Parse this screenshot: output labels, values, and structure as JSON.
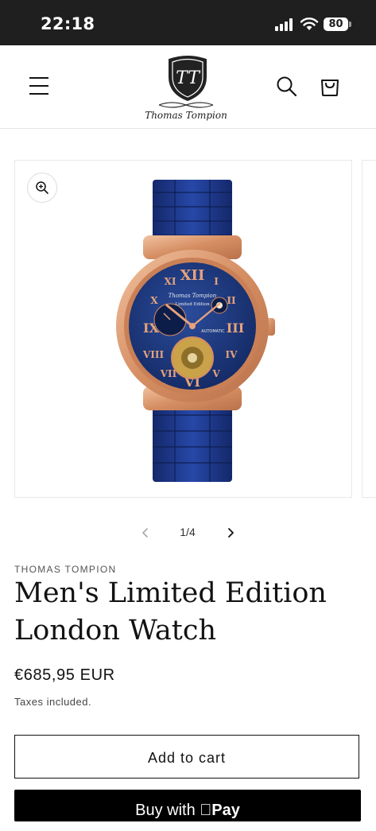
{
  "status_bar": {
    "time": "22:18",
    "battery": "80"
  },
  "header": {
    "brand_name": "Thomas Tompion",
    "logo_monogram": "TT",
    "icons": {
      "menu": "hamburger-menu-icon",
      "search": "search-icon",
      "cart": "shopping-bag-icon"
    }
  },
  "gallery": {
    "pager": "1/4",
    "zoom_icon": "zoom-in-icon",
    "dial_brand": "Thomas Tompion",
    "dial_edition": "Limited Edition",
    "dial_automatic": "AUTOMATIC"
  },
  "product": {
    "vendor": "THOMAS TOMPION",
    "title": "Men's Limited Edition London Watch",
    "price": "€685,95 EUR",
    "tax_note": "Taxes included.",
    "add_to_cart": "Add to cart",
    "buy_with": "Buy with",
    "buy_pay": "Pay"
  },
  "colors": {
    "accent": "#121212",
    "watch_blue": "#1c3a8a",
    "watch_rose_gold": "#d9936a"
  }
}
